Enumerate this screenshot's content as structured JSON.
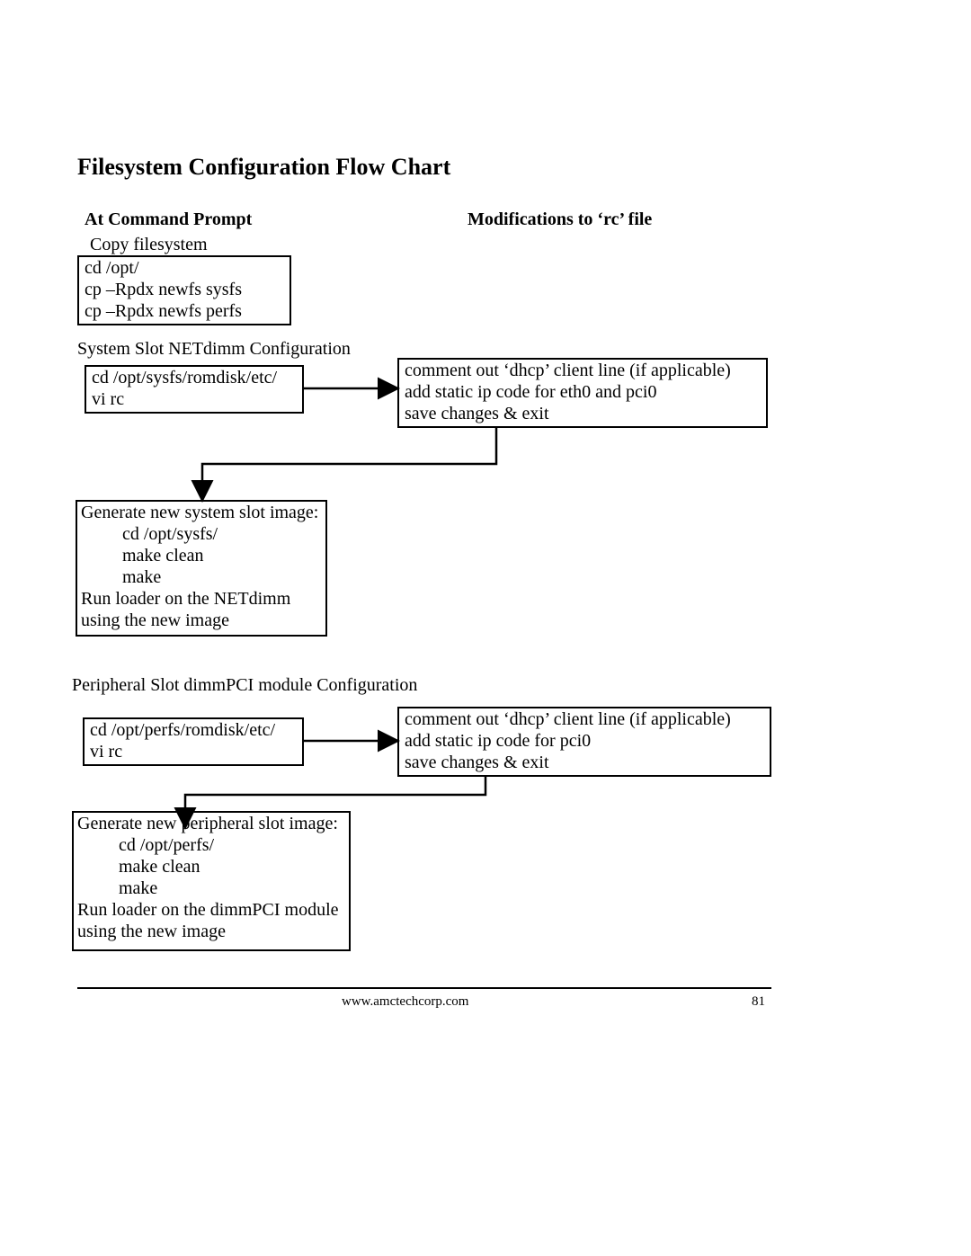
{
  "title": "Filesystem Configuration Flow Chart",
  "columns": {
    "left": "At Command Prompt",
    "right": "Modifications to ‘rc’ file"
  },
  "labels": {
    "copy_fs": "Copy filesystem",
    "sys_config": "System Slot NETdimm Configuration",
    "periph_config": "Peripheral Slot dimmPCI module Configuration"
  },
  "boxes": {
    "copy": {
      "l1": "cd  /opt/",
      "l2": "cp –Rpdx newfs sysfs",
      "l3": "cp –Rpdx newfs perfs"
    },
    "sysfs_edit": {
      "l1": "cd  /opt/sysfs/romdisk/etc/",
      "l2": "vi rc"
    },
    "sysfs_rc": {
      "l1": "comment out ‘dhcp’ client line (if applicable)",
      "l2": "add static ip code for eth0 and pci0",
      "l3": "save changes & exit"
    },
    "sysfs_make": {
      "l1": "Generate new system slot image:",
      "l2": "cd  /opt/sysfs/",
      "l3": "make clean",
      "l4": "make",
      "l5": "Run loader on the NETdimm",
      "l6": "using the new image"
    },
    "perfs_edit": {
      "l1": "cd  /opt/perfs/romdisk/etc/",
      "l2": "vi rc"
    },
    "perfs_rc": {
      "l1": "comment out ‘dhcp’ client line (if applicable)",
      "l2": "add static ip code for pci0",
      "l3": "save changes & exit"
    },
    "perfs_make": {
      "l1": "Generate new peripheral slot image:",
      "l2": "cd  /opt/perfs/",
      "l3": "make clean",
      "l4": "make",
      "l5": "Run loader on the dimmPCI module",
      "l6": "using the new image"
    }
  },
  "footer": {
    "url": "www.amctechcorp.com",
    "page": "81"
  }
}
